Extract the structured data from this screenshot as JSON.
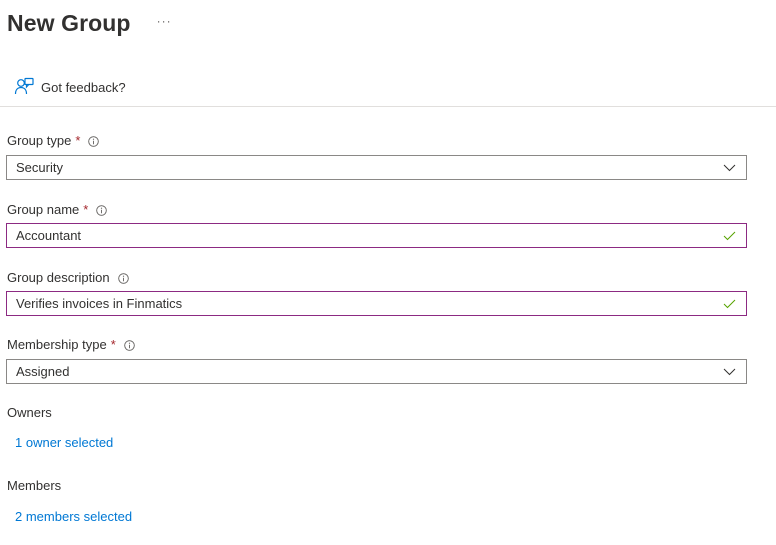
{
  "page": {
    "title": "New Group",
    "more_label": "···"
  },
  "toolbar": {
    "feedback_label": "Got feedback?"
  },
  "form": {
    "group_type": {
      "label": "Group type",
      "required": "*",
      "value": "Security",
      "control": "dropdown"
    },
    "group_name": {
      "label": "Group name",
      "required": "*",
      "value": "Accountant",
      "valid": true
    },
    "group_description": {
      "label": "Group description",
      "value": "Verifies invoices in Finmatics",
      "valid": true
    },
    "membership_type": {
      "label": "Membership type",
      "required": "*",
      "value": "Assigned",
      "control": "dropdown"
    },
    "owners": {
      "label": "Owners",
      "link_text": "1 owner selected"
    },
    "members": {
      "label": "Members",
      "link_text": "2 members selected"
    }
  },
  "icons": {
    "feedback": "feedback-icon",
    "info": "info-icon",
    "dropdown": "chevron-down-icon",
    "valid": "checkmark-icon"
  },
  "colors": {
    "link": "#0078d4",
    "required": "#a4262c",
    "input_focus_border": "#8c2a82",
    "valid_check": "#57a300"
  }
}
